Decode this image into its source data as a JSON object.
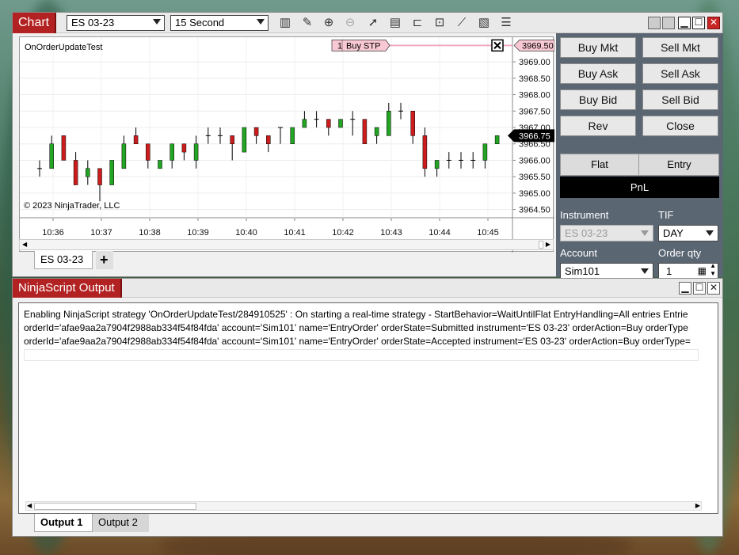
{
  "chart_window": {
    "title": "Chart",
    "instrument": "ES 03-23",
    "interval": "15 Second",
    "toolbar_icons": [
      "bar-type-icon",
      "pencil-icon",
      "zoom-in-icon",
      "zoom-out-icon",
      "pointer-icon",
      "data-box-icon",
      "properties-icon",
      "indicators-icon",
      "strategies-icon",
      "drawing-tools-icon",
      "list-icon"
    ],
    "strategy_label": "OnOrderUpdateTest",
    "copyright": "© 2023 NinjaTrader, LLC",
    "order_marker": {
      "qty": "1",
      "label": "Buy STP",
      "price": "3969.50"
    },
    "last_price": "3966.75",
    "price_axis": [
      "3969.00",
      "3968.50",
      "3968.00",
      "3967.50",
      "3967.00",
      "3966.50",
      "3966.00",
      "3965.50",
      "3965.00",
      "3964.50"
    ],
    "time_axis": [
      "10:36",
      "10:37",
      "10:38",
      "10:39",
      "10:40",
      "10:41",
      "10:42",
      "10:43",
      "10:44",
      "10:45"
    ],
    "tabs": {
      "active": "ES 03-23",
      "add": "+"
    }
  },
  "order_panel": {
    "buttons": [
      "Buy Mkt",
      "Sell Mkt",
      "Buy Ask",
      "Sell Ask",
      "Buy Bid",
      "Sell Bid",
      "Rev",
      "Close"
    ],
    "position": "Flat",
    "atm": "Entry",
    "pnl": "PnL",
    "instrument_label": "Instrument",
    "instrument_value": "ES 03-23",
    "tif_label": "TIF",
    "tif_value": "DAY",
    "account_label": "Account",
    "account_value": "Sim101",
    "qty_label": "Order qty",
    "qty_value": "1"
  },
  "output_window": {
    "title": "NinjaScript Output",
    "lines": [
      "Enabling NinjaScript strategy 'OnOrderUpdateTest/284910525' : On starting a real-time strategy - StartBehavior=WaitUntilFlat EntryHandling=All entries Entrie",
      "orderId='afae9aa2a7904f2988ab334f54f84fda' account='Sim101' name='EntryOrder' orderState=Submitted instrument='ES 03-23' orderAction=Buy orderType",
      "orderId='afae9aa2a7904f2988ab334f54f84fda' account='Sim101' name='EntryOrder' orderState=Accepted instrument='ES 03-23' orderAction=Buy orderType="
    ],
    "tabs": [
      "Output 1",
      "Output 2"
    ]
  },
  "chart_data": {
    "type": "candlestick",
    "y_range": [
      3964.25,
      3969.75
    ],
    "candles": [
      {
        "o": 3965.75,
        "c": 3965.75,
        "h": 3966.0,
        "l": 3965.5
      },
      {
        "o": 3965.75,
        "c": 3966.5,
        "h": 3966.75,
        "l": 3965.75
      },
      {
        "o": 3966.75,
        "c": 3966.0,
        "h": 3966.75,
        "l": 3966.0
      },
      {
        "o": 3966.0,
        "c": 3965.25,
        "h": 3966.25,
        "l": 3965.25
      },
      {
        "o": 3965.5,
        "c": 3965.75,
        "h": 3966.0,
        "l": 3965.25
      },
      {
        "o": 3965.75,
        "c": 3965.25,
        "h": 3965.75,
        "l": 3964.75
      },
      {
        "o": 3965.25,
        "c": 3966.0,
        "h": 3966.0,
        "l": 3965.25
      },
      {
        "o": 3965.75,
        "c": 3966.5,
        "h": 3966.75,
        "l": 3965.75
      },
      {
        "o": 3966.75,
        "c": 3966.5,
        "h": 3967.0,
        "l": 3966.5
      },
      {
        "o": 3966.5,
        "c": 3966.0,
        "h": 3966.5,
        "l": 3965.75
      },
      {
        "o": 3965.75,
        "c": 3966.0,
        "h": 3966.0,
        "l": 3965.75
      },
      {
        "o": 3966.0,
        "c": 3966.5,
        "h": 3966.5,
        "l": 3965.75
      },
      {
        "o": 3966.5,
        "c": 3966.25,
        "h": 3966.5,
        "l": 3966.0
      },
      {
        "o": 3966.0,
        "c": 3966.5,
        "h": 3966.75,
        "l": 3965.75
      },
      {
        "o": 3966.75,
        "c": 3966.75,
        "h": 3967.0,
        "l": 3966.5
      },
      {
        "o": 3966.75,
        "c": 3966.75,
        "h": 3967.0,
        "l": 3966.5
      },
      {
        "o": 3966.75,
        "c": 3966.5,
        "h": 3966.75,
        "l": 3966.0
      },
      {
        "o": 3966.25,
        "c": 3967.0,
        "h": 3967.0,
        "l": 3966.25
      },
      {
        "o": 3967.0,
        "c": 3966.75,
        "h": 3967.0,
        "l": 3966.5
      },
      {
        "o": 3966.75,
        "c": 3966.5,
        "h": 3966.75,
        "l": 3966.25
      },
      {
        "o": 3967.0,
        "c": 3967.0,
        "h": 3967.0,
        "l": 3966.5
      },
      {
        "o": 3966.5,
        "c": 3967.0,
        "h": 3967.0,
        "l": 3966.5
      },
      {
        "o": 3967.0,
        "c": 3967.25,
        "h": 3967.5,
        "l": 3967.0
      },
      {
        "o": 3967.25,
        "c": 3967.25,
        "h": 3967.5,
        "l": 3967.0
      },
      {
        "o": 3967.25,
        "c": 3967.0,
        "h": 3967.25,
        "l": 3966.75
      },
      {
        "o": 3967.0,
        "c": 3967.25,
        "h": 3967.25,
        "l": 3967.0
      },
      {
        "o": 3967.25,
        "c": 3967.25,
        "h": 3967.5,
        "l": 3966.75
      },
      {
        "o": 3967.25,
        "c": 3966.5,
        "h": 3967.25,
        "l": 3966.5
      },
      {
        "o": 3966.75,
        "c": 3967.0,
        "h": 3967.0,
        "l": 3966.5
      },
      {
        "o": 3966.75,
        "c": 3967.5,
        "h": 3967.75,
        "l": 3966.75
      },
      {
        "o": 3967.5,
        "c": 3967.5,
        "h": 3967.75,
        "l": 3967.25
      },
      {
        "o": 3967.5,
        "c": 3966.75,
        "h": 3967.5,
        "l": 3966.5
      },
      {
        "o": 3966.75,
        "c": 3965.75,
        "h": 3967.0,
        "l": 3965.5
      },
      {
        "o": 3965.75,
        "c": 3966.0,
        "h": 3966.0,
        "l": 3965.5
      },
      {
        "o": 3966.0,
        "c": 3966.0,
        "h": 3966.25,
        "l": 3965.75
      },
      {
        "o": 3966.0,
        "c": 3966.0,
        "h": 3966.25,
        "l": 3965.75
      },
      {
        "o": 3966.0,
        "c": 3966.0,
        "h": 3966.25,
        "l": 3965.75
      },
      {
        "o": 3966.0,
        "c": 3966.5,
        "h": 3966.5,
        "l": 3965.75
      },
      {
        "o": 3966.5,
        "c": 3966.75,
        "h": 3966.75,
        "l": 3966.5
      }
    ]
  }
}
